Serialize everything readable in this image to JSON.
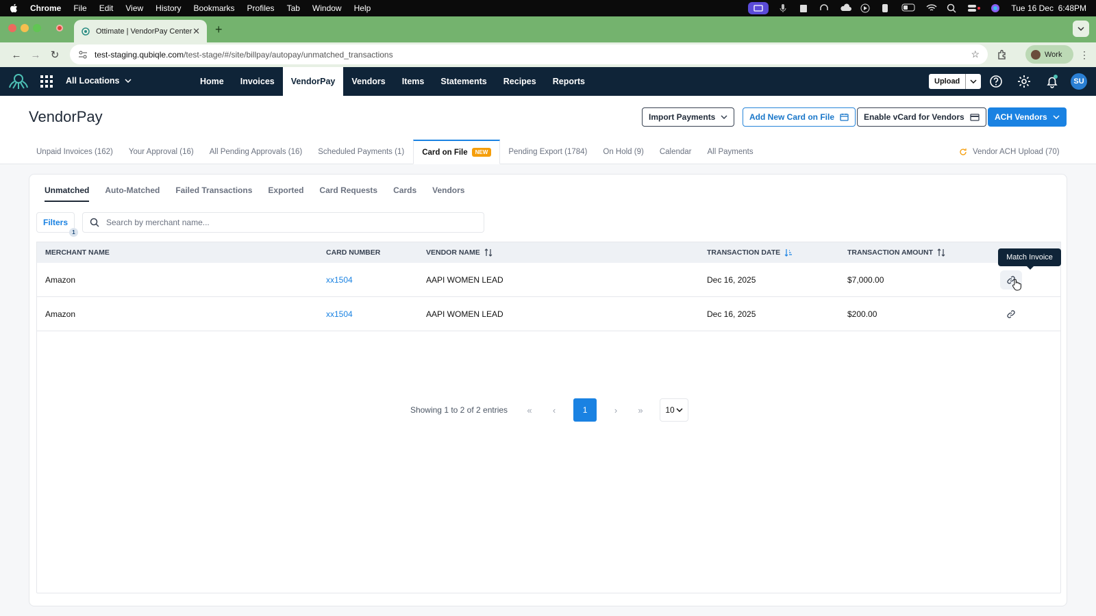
{
  "menubar": {
    "apple": "",
    "items": [
      "Chrome",
      "File",
      "Edit",
      "View",
      "History",
      "Bookmarks",
      "Profiles",
      "Tab",
      "Window",
      "Help"
    ],
    "datetime": "Tue 16 Dec  6:48PM"
  },
  "browser": {
    "tab_title": "Ottimate | VendorPay Center",
    "url_host": "test-staging.qubiqle.com",
    "url_path": "/test-stage/#/site/billpay/autopay/unmatched_transactions",
    "profile": "Work"
  },
  "topnav": {
    "location": "All Locations",
    "links": [
      "Home",
      "Invoices",
      "VendorPay",
      "Vendors",
      "Items",
      "Statements",
      "Recipes",
      "Reports"
    ],
    "active": "VendorPay",
    "upload_label": "Upload",
    "avatar": "SU"
  },
  "page": {
    "title": "VendorPay",
    "import_payments": "Import Payments",
    "add_card": "Add New Card on File",
    "enable_vcard": "Enable vCard for Vendors",
    "ach_vendors": "ACH Vendors"
  },
  "main_tabs": {
    "unpaid": "Unpaid Invoices (162)",
    "your_approval": "Your Approval (16)",
    "pending_approvals": "All Pending Approvals (16)",
    "scheduled": "Scheduled Payments (1)",
    "card_on_file": "Card on File",
    "new_badge": "NEW",
    "pending_export": "Pending Export (1784)",
    "on_hold": "On Hold (9)",
    "calendar": "Calendar",
    "all_payments": "All Payments",
    "ach_upload": "Vendor ACH Upload (70)"
  },
  "sub_tabs": {
    "unmatched": "Unmatched",
    "auto_matched": "Auto-Matched",
    "failed": "Failed Transactions",
    "exported": "Exported",
    "card_requests": "Card Requests",
    "cards": "Cards",
    "vendors": "Vendors"
  },
  "filters": {
    "label": "Filters",
    "count": "1"
  },
  "search": {
    "placeholder": "Search by merchant name...",
    "value": ""
  },
  "table": {
    "headers": {
      "merchant": "MERCHANT NAME",
      "card": "CARD NUMBER",
      "vendor": "VENDOR NAME",
      "date": "TRANSACTION DATE",
      "amount": "TRANSACTION AMOUNT"
    },
    "rows": [
      {
        "merchant": "Amazon",
        "card": "xx1504",
        "vendor": "AAPI WOMEN LEAD",
        "date": "Dec 16, 2025",
        "amount": "$7,000.00"
      },
      {
        "merchant": "Amazon",
        "card": "xx1504",
        "vendor": "AAPI WOMEN LEAD",
        "date": "Dec 16, 2025",
        "amount": "$200.00"
      }
    ],
    "tooltip": "Match Invoice"
  },
  "pagination": {
    "summary": "Showing 1 to 2 of 2 entries",
    "current_page": "1",
    "page_size": "10"
  },
  "colors": {
    "accent": "#1a82e2",
    "nav_bg": "#0f2438",
    "browser_green": "#74b36e",
    "badge": "#f59e0b"
  }
}
